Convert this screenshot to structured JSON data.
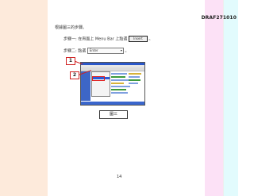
{
  "header": {
    "doc_id": "DRAF271010"
  },
  "intro": "根據圖三的步驟。",
  "steps": [
    {
      "prefix": "步驟一: 在頁面上 Menu Bar 上點選",
      "button": "Insert",
      "suffix": "。"
    },
    {
      "prefix": "步驟二: 點選",
      "dropdown": "Enter",
      "suffix": "。"
    }
  ],
  "callouts": [
    "1",
    "2"
  ],
  "caption": "圖三",
  "page_number": "14"
}
